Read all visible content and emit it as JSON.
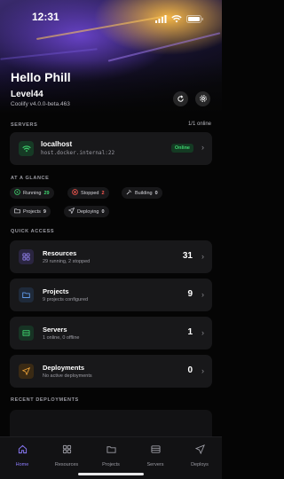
{
  "status_bar": {
    "time": "12:31"
  },
  "header": {
    "greeting": "Hello Phill",
    "team": "Level44",
    "version": "Coolify v4.0.0-beta.463",
    "buttons": [
      {
        "icon": "refresh-icon"
      },
      {
        "icon": "gear-icon"
      }
    ]
  },
  "servers_section": {
    "label": "SERVERS",
    "summary": "1/1 online",
    "server": {
      "name": "localhost",
      "host": "host.docker.internal:22",
      "status": "Online",
      "icon": "wifi-icon"
    }
  },
  "glance": {
    "label": "AT A GLANCE",
    "items": [
      {
        "label": "Running",
        "value": "29",
        "icon": "play-circle-icon",
        "color": "#3ed36e"
      },
      {
        "label": "Stopped",
        "value": "2",
        "icon": "stop-circle-icon",
        "color": "#ff5a52"
      },
      {
        "label": "Building",
        "value": "0",
        "icon": "hammer-icon",
        "color": "#ffffff"
      },
      {
        "label": "Projects",
        "value": "9",
        "icon": "folder-icon",
        "color": "#ffffff"
      },
      {
        "label": "Deploying",
        "value": "0",
        "icon": "send-icon",
        "color": "#ffffff"
      }
    ]
  },
  "quick_access": {
    "label": "QUICK ACCESS",
    "items": [
      {
        "title": "Resources",
        "subtitle": "29 running, 2 stopped",
        "count": "31",
        "icon": "grid-icon",
        "icon_bg": "#2a2540",
        "icon_color": "#9d8cff"
      },
      {
        "title": "Projects",
        "subtitle": "9 projects configured",
        "count": "9",
        "icon": "folder-icon",
        "icon_bg": "#1f2a3a",
        "icon_color": "#6aa8ff"
      },
      {
        "title": "Servers",
        "subtitle": "1 online, 0 offline",
        "count": "1",
        "icon": "server-icon",
        "icon_bg": "#173324",
        "icon_color": "#3ed36e"
      },
      {
        "title": "Deployments",
        "subtitle": "No active deployments",
        "count": "0",
        "icon": "send-icon",
        "icon_bg": "#3a2a14",
        "icon_color": "#f0a53a"
      }
    ]
  },
  "recent": {
    "label": "RECENT DEPLOYMENTS"
  },
  "tabbar": {
    "tabs": [
      {
        "label": "Home",
        "icon": "home-icon",
        "active": true
      },
      {
        "label": "Resources",
        "icon": "grid-icon",
        "active": false
      },
      {
        "label": "Projects",
        "icon": "folder-icon",
        "active": false
      },
      {
        "label": "Servers",
        "icon": "server-icon",
        "active": false
      },
      {
        "label": "Deploys",
        "icon": "send-icon",
        "active": false
      }
    ]
  },
  "colors": {
    "accent": "#8e7dff",
    "online": "#3ed36e",
    "stopped": "#ff5a52"
  }
}
